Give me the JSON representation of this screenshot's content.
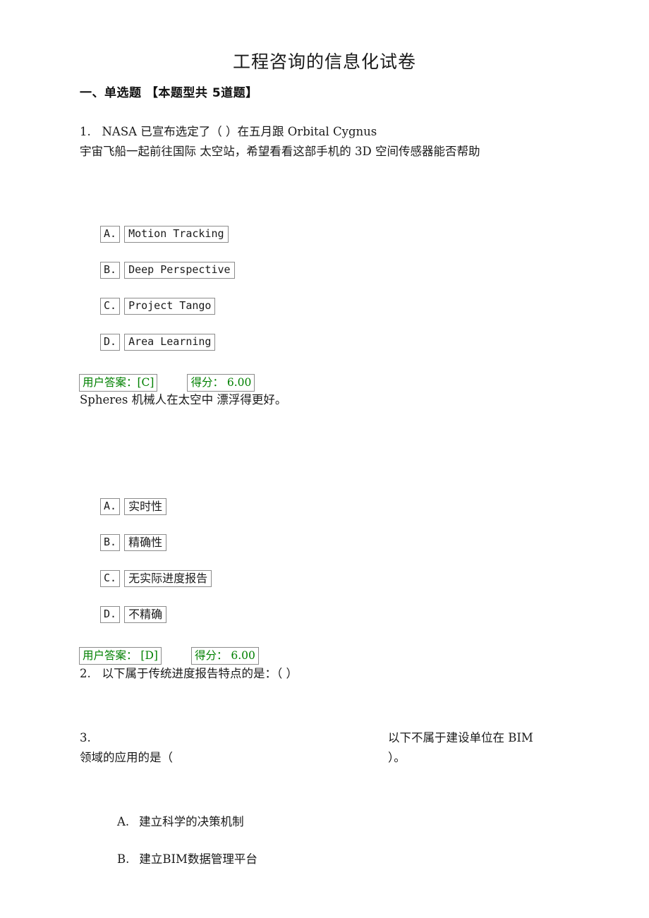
{
  "document": {
    "title": "工程咨询的信息化试卷",
    "section_heading": "一、单选题 【本题型共 5道题】"
  },
  "questions": [
    {
      "number": "1.",
      "stem_line1": "1.   NASA 已宣布选定了（ ）在五月跟 Orbital Cygnus",
      "stem_line2": "宇宙飞船一起前往国际 太空站，希望看看这部手机的 3D 空间传感器能否帮助",
      "options": [
        {
          "letter": "A.",
          "text": "Motion Tracking"
        },
        {
          "letter": "B.",
          "text": "Deep Perspective"
        },
        {
          "letter": "C.",
          "text": "Project Tango"
        },
        {
          "letter": "D.",
          "text": "Area Learning"
        }
      ],
      "user_answer": "用户答案：[C]",
      "score": "得分： 6.00",
      "explanation": "Spheres 机械人在太空中 漂浮得更好。"
    },
    {
      "number": "2.",
      "stem": "2.   以下属于传统进度报告特点的是：（ ）",
      "options": [
        {
          "letter": "A.",
          "text": "实时性"
        },
        {
          "letter": "B.",
          "text": "精确性"
        },
        {
          "letter": "C.",
          "text": "无实际进度报告"
        },
        {
          "letter": "D.",
          "text": "不精确"
        }
      ],
      "user_answer": "用户答案： [D]",
      "score": "得分： 6.00"
    },
    {
      "number": "3.",
      "stem_left_line1": "3.",
      "stem_left_line2": "领域的应用的是（",
      "stem_right_line1": "以下不属于建设单位在 BIM",
      "stem_right_line2": "）。",
      "options": [
        {
          "letter": "A.",
          "text": "建立科学的决策机制"
        },
        {
          "letter": "B.",
          "text": "建立BIM数据管理平台"
        }
      ]
    }
  ],
  "colors": {
    "answer_green": "#008000",
    "text_black": "#1a1a1a",
    "box_border": "#8c8c8c"
  }
}
